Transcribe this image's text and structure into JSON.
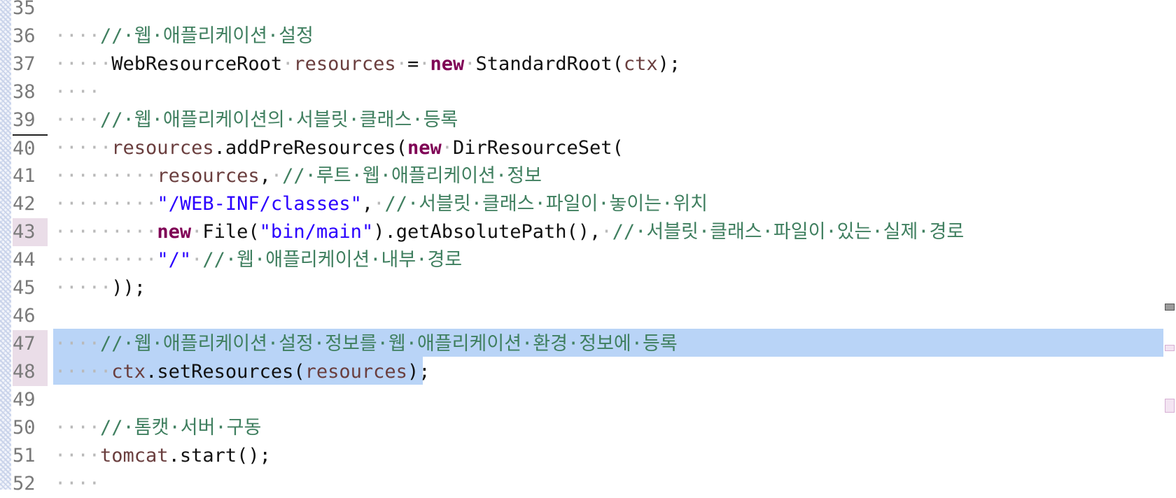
{
  "editor": {
    "lines": [
      {
        "num": "35",
        "marked": false,
        "current": false,
        "tokens": []
      },
      {
        "num": "36",
        "marked": false,
        "current": false,
        "tokens": [
          {
            "t": "ws",
            "v": "····"
          },
          {
            "t": "cm",
            "v": "//·웹·애플리케이션·설정"
          }
        ]
      },
      {
        "num": "37",
        "marked": false,
        "current": false,
        "tokens": [
          {
            "t": "ws",
            "v": "·····"
          },
          {
            "t": "pl",
            "v": "WebResourceRoot"
          },
          {
            "t": "ws",
            "v": "·"
          },
          {
            "t": "var",
            "v": "resources"
          },
          {
            "t": "ws",
            "v": "·"
          },
          {
            "t": "pl",
            "v": "="
          },
          {
            "t": "ws",
            "v": "·"
          },
          {
            "t": "kw",
            "v": "new"
          },
          {
            "t": "ws",
            "v": "·"
          },
          {
            "t": "pl",
            "v": "StandardRoot("
          },
          {
            "t": "var",
            "v": "ctx"
          },
          {
            "t": "pl",
            "v": ");"
          }
        ]
      },
      {
        "num": "38",
        "marked": false,
        "current": false,
        "tokens": [
          {
            "t": "ws",
            "v": "····"
          }
        ]
      },
      {
        "num": "39",
        "marked": false,
        "current": false,
        "tokens": [
          {
            "t": "ws",
            "v": "····"
          },
          {
            "t": "cm",
            "v": "//·웹·애플리케이션의·서블릿·클래스·등록"
          }
        ]
      },
      {
        "num": "40",
        "marked": false,
        "current": true,
        "tokens": [
          {
            "t": "ws",
            "v": "·····"
          },
          {
            "t": "var",
            "v": "resources"
          },
          {
            "t": "pl",
            "v": ".addPreResources("
          },
          {
            "t": "kw",
            "v": "new"
          },
          {
            "t": "ws",
            "v": "·"
          },
          {
            "t": "pl",
            "v": "DirResourceSet("
          }
        ]
      },
      {
        "num": "41",
        "marked": false,
        "current": false,
        "tokens": [
          {
            "t": "ws",
            "v": "·········"
          },
          {
            "t": "var",
            "v": "resources"
          },
          {
            "t": "pl",
            "v": ","
          },
          {
            "t": "ws",
            "v": "·"
          },
          {
            "t": "cm",
            "v": "//·루트·웹·애플리케이션·정보"
          }
        ]
      },
      {
        "num": "42",
        "marked": false,
        "current": false,
        "tokens": [
          {
            "t": "ws",
            "v": "·········"
          },
          {
            "t": "str",
            "v": "\"/WEB-INF/classes\""
          },
          {
            "t": "pl",
            "v": ","
          },
          {
            "t": "ws",
            "v": "·"
          },
          {
            "t": "cm",
            "v": "//·서블릿·클래스·파일이·놓이는·위치"
          }
        ]
      },
      {
        "num": "43",
        "marked": true,
        "current": false,
        "tokens": [
          {
            "t": "ws",
            "v": "·········"
          },
          {
            "t": "kw",
            "v": "new"
          },
          {
            "t": "ws",
            "v": "·"
          },
          {
            "t": "pl",
            "v": "File("
          },
          {
            "t": "str",
            "v": "\"bin/main\""
          },
          {
            "t": "pl",
            "v": ").getAbsolutePath(),"
          },
          {
            "t": "ws",
            "v": "·"
          },
          {
            "t": "cm",
            "v": "//·서블릿·클래스·파일이·있는·실제·경로"
          }
        ]
      },
      {
        "num": "44",
        "marked": false,
        "current": false,
        "tokens": [
          {
            "t": "ws",
            "v": "·········"
          },
          {
            "t": "str",
            "v": "\"/\""
          },
          {
            "t": "ws",
            "v": "·"
          },
          {
            "t": "cm",
            "v": "//·웹·애플리케이션·내부·경로"
          }
        ]
      },
      {
        "num": "45",
        "marked": false,
        "current": false,
        "tokens": [
          {
            "t": "ws",
            "v": "·····"
          },
          {
            "t": "pl",
            "v": "));"
          }
        ]
      },
      {
        "num": "46",
        "marked": false,
        "current": false,
        "tokens": []
      },
      {
        "num": "47",
        "marked": true,
        "current": false,
        "tokens": [
          {
            "t": "ws",
            "v": "····"
          },
          {
            "t": "cm",
            "v": "//·웹·애플리케이션·설정·정보를·웹·애플리케이션·환경·정보에·등록"
          }
        ]
      },
      {
        "num": "48",
        "marked": true,
        "current": false,
        "tokens": [
          {
            "t": "ws",
            "v": "·····"
          },
          {
            "t": "var",
            "v": "ctx"
          },
          {
            "t": "pl",
            "v": ".setResources("
          },
          {
            "t": "var",
            "v": "resources"
          },
          {
            "t": "pl",
            "v": ");"
          }
        ]
      },
      {
        "num": "49",
        "marked": false,
        "current": false,
        "tokens": []
      },
      {
        "num": "50",
        "marked": false,
        "current": false,
        "tokens": [
          {
            "t": "ws",
            "v": "····"
          },
          {
            "t": "cm",
            "v": "//·톰캣·서버·구동"
          }
        ]
      },
      {
        "num": "51",
        "marked": false,
        "current": false,
        "tokens": [
          {
            "t": "ws",
            "v": "····"
          },
          {
            "t": "var",
            "v": "tomcat"
          },
          {
            "t": "pl",
            "v": ".start();"
          }
        ]
      },
      {
        "num": "52",
        "marked": false,
        "current": false,
        "tokens": [
          {
            "t": "ws",
            "v": "····"
          }
        ]
      }
    ],
    "selection": {
      "start_line": "47",
      "end_line": "48"
    }
  },
  "colors": {
    "comment": "#3f7f5f",
    "keyword": "#7f0055",
    "string": "#2a00ff",
    "variable": "#6a3e3e",
    "whitespace": "#b9b9b9",
    "selection": "#b9d4f7"
  }
}
